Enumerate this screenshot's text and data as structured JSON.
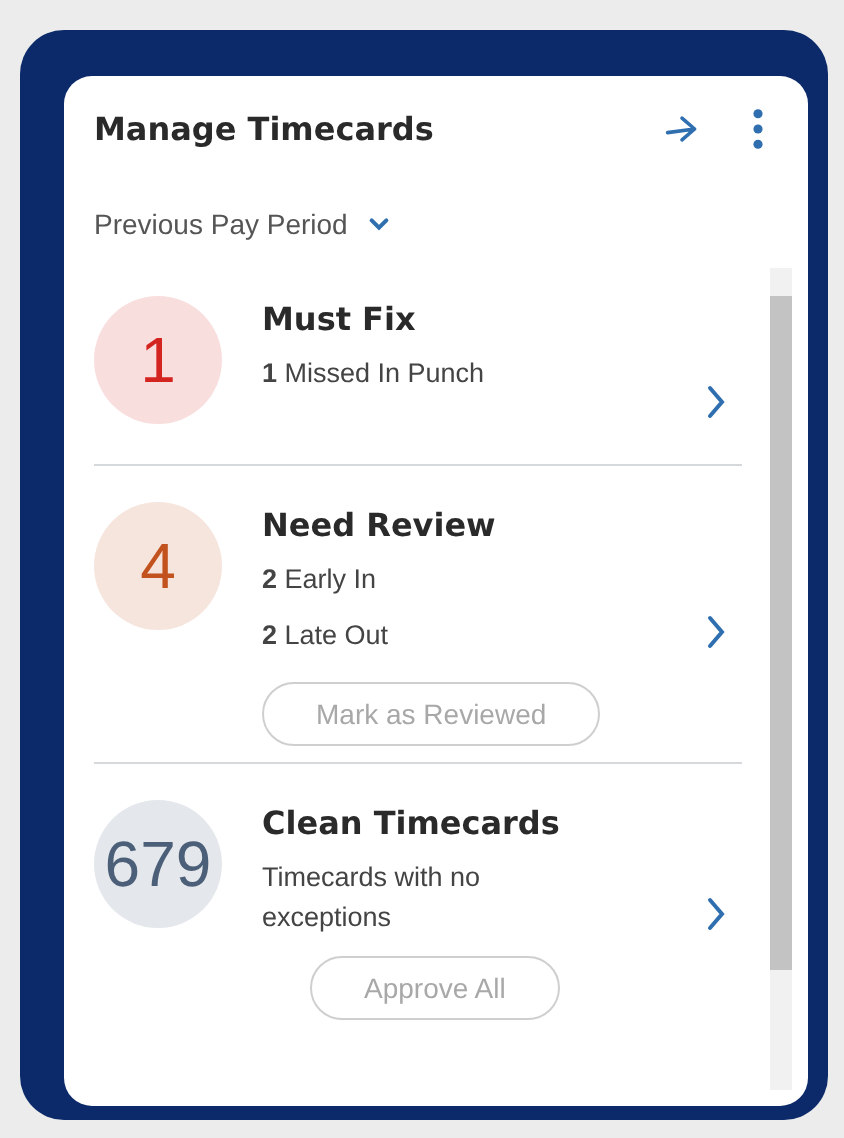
{
  "card": {
    "title": "Manage Timecards"
  },
  "period": {
    "label": "Previous Pay Period"
  },
  "groups": [
    {
      "count": "1",
      "color": "#d42420",
      "title": "Must Fix",
      "lines": [
        "**1** Missed In Punch"
      ]
    },
    {
      "count": "4",
      "color": "#c2521e",
      "title": "Need Review",
      "lines": [
        "**2** Early In",
        "**2** Late Out"
      ],
      "action": {
        "label": "Mark as Reviewed",
        "disabled": true
      }
    },
    {
      "count": "679",
      "color": "#4c5f78",
      "title": "Clean Timecards",
      "lines": [
        "Timecards with no exceptions"
      ],
      "action": {
        "label": "Approve All",
        "disabled": true
      }
    }
  ]
}
